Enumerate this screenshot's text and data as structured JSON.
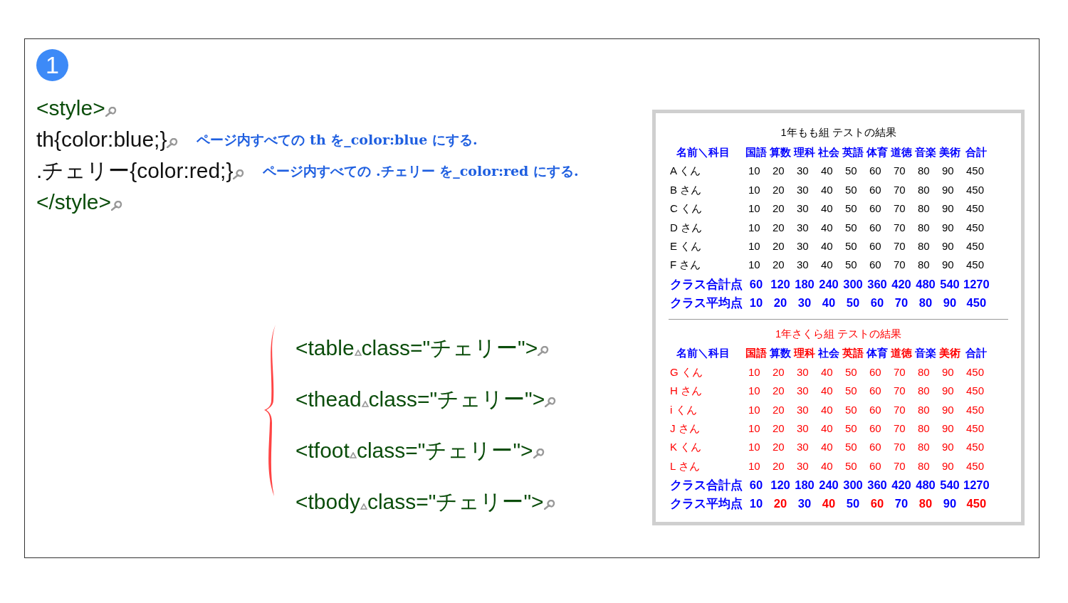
{
  "step_badge": "1",
  "code_lines": [
    {
      "kind": "tag",
      "text": "<style>"
    },
    {
      "kind": "rule",
      "text": "th{color:blue;}",
      "note": "ページ内すべての th を_color:blue にする."
    },
    {
      "kind": "rule",
      "text": ".チェリー{color:red;}",
      "note": "ページ内すべての .チェリー を_color:red にする."
    },
    {
      "kind": "tag",
      "text": "</style>"
    }
  ],
  "tag_lines": [
    {
      "tag": "<table",
      "attribute": "class=\"チェリー\">"
    },
    {
      "tag": "<thead",
      "attribute": "class=\"チェリー\">"
    },
    {
      "tag": "<tfoot",
      "attribute": "class=\"チェリー\">"
    },
    {
      "tag": "<tbody",
      "attribute": "class=\"チェリー\">"
    }
  ],
  "tables": [
    {
      "caption": {
        "text": "1年もも組 テストの結果",
        "color": "#000000"
      },
      "header": [
        {
          "text": "名前＼科目",
          "color": "#0000ff"
        },
        {
          "text": "国語",
          "color": "#0000ff"
        },
        {
          "text": "算数",
          "color": "#0000ff"
        },
        {
          "text": "理科",
          "color": "#0000ff"
        },
        {
          "text": "社会",
          "color": "#0000ff"
        },
        {
          "text": "英語",
          "color": "#0000ff"
        },
        {
          "text": "体育",
          "color": "#0000ff"
        },
        {
          "text": "道徳",
          "color": "#0000ff"
        },
        {
          "text": "音楽",
          "color": "#0000ff"
        },
        {
          "text": "美術",
          "color": "#0000ff"
        },
        {
          "text": "合計",
          "color": "#0000ff"
        }
      ],
      "rows": [
        {
          "color": "#000000",
          "cells": [
            "A くん",
            "10",
            "20",
            "30",
            "40",
            "50",
            "60",
            "70",
            "80",
            "90",
            "450"
          ]
        },
        {
          "color": "#000000",
          "cells": [
            "B さん",
            "10",
            "20",
            "30",
            "40",
            "50",
            "60",
            "70",
            "80",
            "90",
            "450"
          ]
        },
        {
          "color": "#000000",
          "cells": [
            "C くん",
            "10",
            "20",
            "30",
            "40",
            "50",
            "60",
            "70",
            "80",
            "90",
            "450"
          ]
        },
        {
          "color": "#000000",
          "cells": [
            "D さん",
            "10",
            "20",
            "30",
            "40",
            "50",
            "60",
            "70",
            "80",
            "90",
            "450"
          ]
        },
        {
          "color": "#000000",
          "cells": [
            "E くん",
            "10",
            "20",
            "30",
            "40",
            "50",
            "60",
            "70",
            "80",
            "90",
            "450"
          ]
        },
        {
          "color": "#000000",
          "cells": [
            "F さん",
            "10",
            "20",
            "30",
            "40",
            "50",
            "60",
            "70",
            "80",
            "90",
            "450"
          ]
        }
      ],
      "footer": [
        [
          {
            "text": "クラス合計点",
            "color": "#0000ff"
          },
          {
            "text": "60",
            "color": "#0000ff"
          },
          {
            "text": "120",
            "color": "#0000ff"
          },
          {
            "text": "180",
            "color": "#0000ff"
          },
          {
            "text": "240",
            "color": "#0000ff"
          },
          {
            "text": "300",
            "color": "#0000ff"
          },
          {
            "text": "360",
            "color": "#0000ff"
          },
          {
            "text": "420",
            "color": "#0000ff"
          },
          {
            "text": "480",
            "color": "#0000ff"
          },
          {
            "text": "540",
            "color": "#0000ff"
          },
          {
            "text": "1270",
            "color": "#0000ff"
          }
        ],
        [
          {
            "text": "クラス平均点",
            "color": "#0000ff"
          },
          {
            "text": "10",
            "color": "#0000ff"
          },
          {
            "text": "20",
            "color": "#0000ff"
          },
          {
            "text": "30",
            "color": "#0000ff"
          },
          {
            "text": "40",
            "color": "#0000ff"
          },
          {
            "text": "50",
            "color": "#0000ff"
          },
          {
            "text": "60",
            "color": "#0000ff"
          },
          {
            "text": "70",
            "color": "#0000ff"
          },
          {
            "text": "80",
            "color": "#0000ff"
          },
          {
            "text": "90",
            "color": "#0000ff"
          },
          {
            "text": "450",
            "color": "#0000ff"
          }
        ]
      ]
    },
    {
      "caption": {
        "text": "1年さくら組 テストの結果",
        "color": "#ff0000"
      },
      "header": [
        {
          "text": "名前＼科目",
          "color": "#0000ff"
        },
        {
          "text": "国語",
          "color": "#ff0000"
        },
        {
          "text": "算数",
          "color": "#0000ff"
        },
        {
          "text": "理科",
          "color": "#ff0000"
        },
        {
          "text": "社会",
          "color": "#0000ff"
        },
        {
          "text": "英語",
          "color": "#ff0000"
        },
        {
          "text": "体育",
          "color": "#0000ff"
        },
        {
          "text": "道徳",
          "color": "#ff0000"
        },
        {
          "text": "音楽",
          "color": "#0000ff"
        },
        {
          "text": "美術",
          "color": "#ff0000"
        },
        {
          "text": "合計",
          "color": "#0000ff"
        }
      ],
      "rows": [
        {
          "color": "#ff0000",
          "cells": [
            "G くん",
            "10",
            "20",
            "30",
            "40",
            "50",
            "60",
            "70",
            "80",
            "90",
            "450"
          ]
        },
        {
          "color": "#ff0000",
          "cells": [
            "H さん",
            "10",
            "20",
            "30",
            "40",
            "50",
            "60",
            "70",
            "80",
            "90",
            "450"
          ]
        },
        {
          "color": "#ff0000",
          "cells": [
            "i くん",
            "10",
            "20",
            "30",
            "40",
            "50",
            "60",
            "70",
            "80",
            "90",
            "450"
          ]
        },
        {
          "color": "#ff0000",
          "cells": [
            "J さん",
            "10",
            "20",
            "30",
            "40",
            "50",
            "60",
            "70",
            "80",
            "90",
            "450"
          ]
        },
        {
          "color": "#ff0000",
          "cells": [
            "K くん",
            "10",
            "20",
            "30",
            "40",
            "50",
            "60",
            "70",
            "80",
            "90",
            "450"
          ]
        },
        {
          "color": "#ff0000",
          "cells": [
            "L さん",
            "10",
            "20",
            "30",
            "40",
            "50",
            "60",
            "70",
            "80",
            "90",
            "450"
          ]
        }
      ],
      "footer": [
        [
          {
            "text": "クラス合計点",
            "color": "#0000ff"
          },
          {
            "text": "60",
            "color": "#0000ff"
          },
          {
            "text": "120",
            "color": "#0000ff"
          },
          {
            "text": "180",
            "color": "#0000ff"
          },
          {
            "text": "240",
            "color": "#0000ff"
          },
          {
            "text": "300",
            "color": "#0000ff"
          },
          {
            "text": "360",
            "color": "#0000ff"
          },
          {
            "text": "420",
            "color": "#0000ff"
          },
          {
            "text": "480",
            "color": "#0000ff"
          },
          {
            "text": "540",
            "color": "#0000ff"
          },
          {
            "text": "1270",
            "color": "#0000ff"
          }
        ],
        [
          {
            "text": "クラス平均点",
            "color": "#0000ff"
          },
          {
            "text": "10",
            "color": "#0000ff"
          },
          {
            "text": "20",
            "color": "#ff0000"
          },
          {
            "text": "30",
            "color": "#0000ff"
          },
          {
            "text": "40",
            "color": "#ff0000"
          },
          {
            "text": "50",
            "color": "#0000ff"
          },
          {
            "text": "60",
            "color": "#ff0000"
          },
          {
            "text": "70",
            "color": "#0000ff"
          },
          {
            "text": "80",
            "color": "#ff0000"
          },
          {
            "text": "90",
            "color": "#0000ff"
          },
          {
            "text": "450",
            "color": "#ff0000"
          }
        ]
      ]
    }
  ]
}
